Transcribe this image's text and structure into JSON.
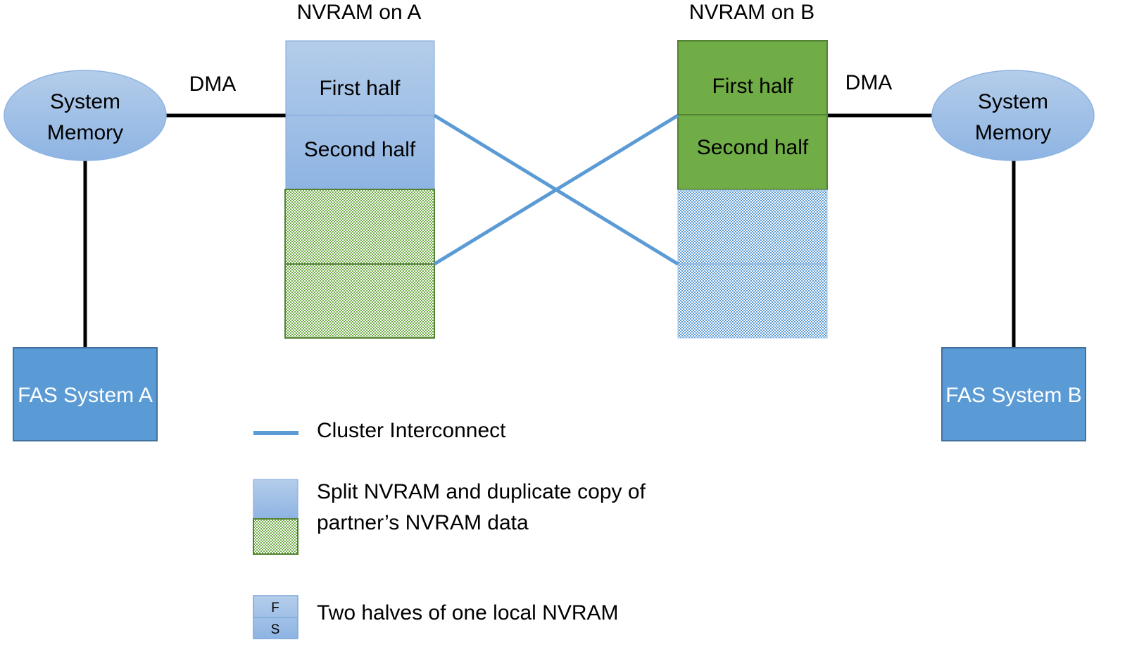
{
  "diagram": {
    "nvram_a": {
      "title": "NVRAM on A",
      "first_half": "First half",
      "second_half": "Second half",
      "local_color": "#9DC3E6",
      "mirror_color": "#70AD47"
    },
    "nvram_b": {
      "title": "NVRAM on B",
      "first_half": "First half",
      "second_half": "Second half",
      "local_color": "#70AD47",
      "mirror_color": "#5B9BD5"
    },
    "system_memory_a": {
      "line1": "System",
      "line2": "Memory"
    },
    "system_memory_b": {
      "line1": "System",
      "line2": "Memory"
    },
    "dma_a": "DMA",
    "dma_b": "DMA",
    "fas_a": "FAS System A",
    "fas_b": "FAS System B",
    "colors": {
      "interconnect": "#5B9BD5",
      "fas_box": "#5B9BD5",
      "fas_border": "#41719C",
      "connector": "#000000"
    }
  },
  "legend": {
    "items": [
      {
        "icon": "blue-line",
        "label": "Cluster Interconnect"
      },
      {
        "icon": "blue-green-stack",
        "label_line1": "Split NVRAM and duplicate copy of",
        "label_line2": "partner’s NVRAM data"
      },
      {
        "icon": "fs-stack",
        "f": "F",
        "s": "S",
        "label": "Two halves of one local NVRAM"
      }
    ]
  }
}
